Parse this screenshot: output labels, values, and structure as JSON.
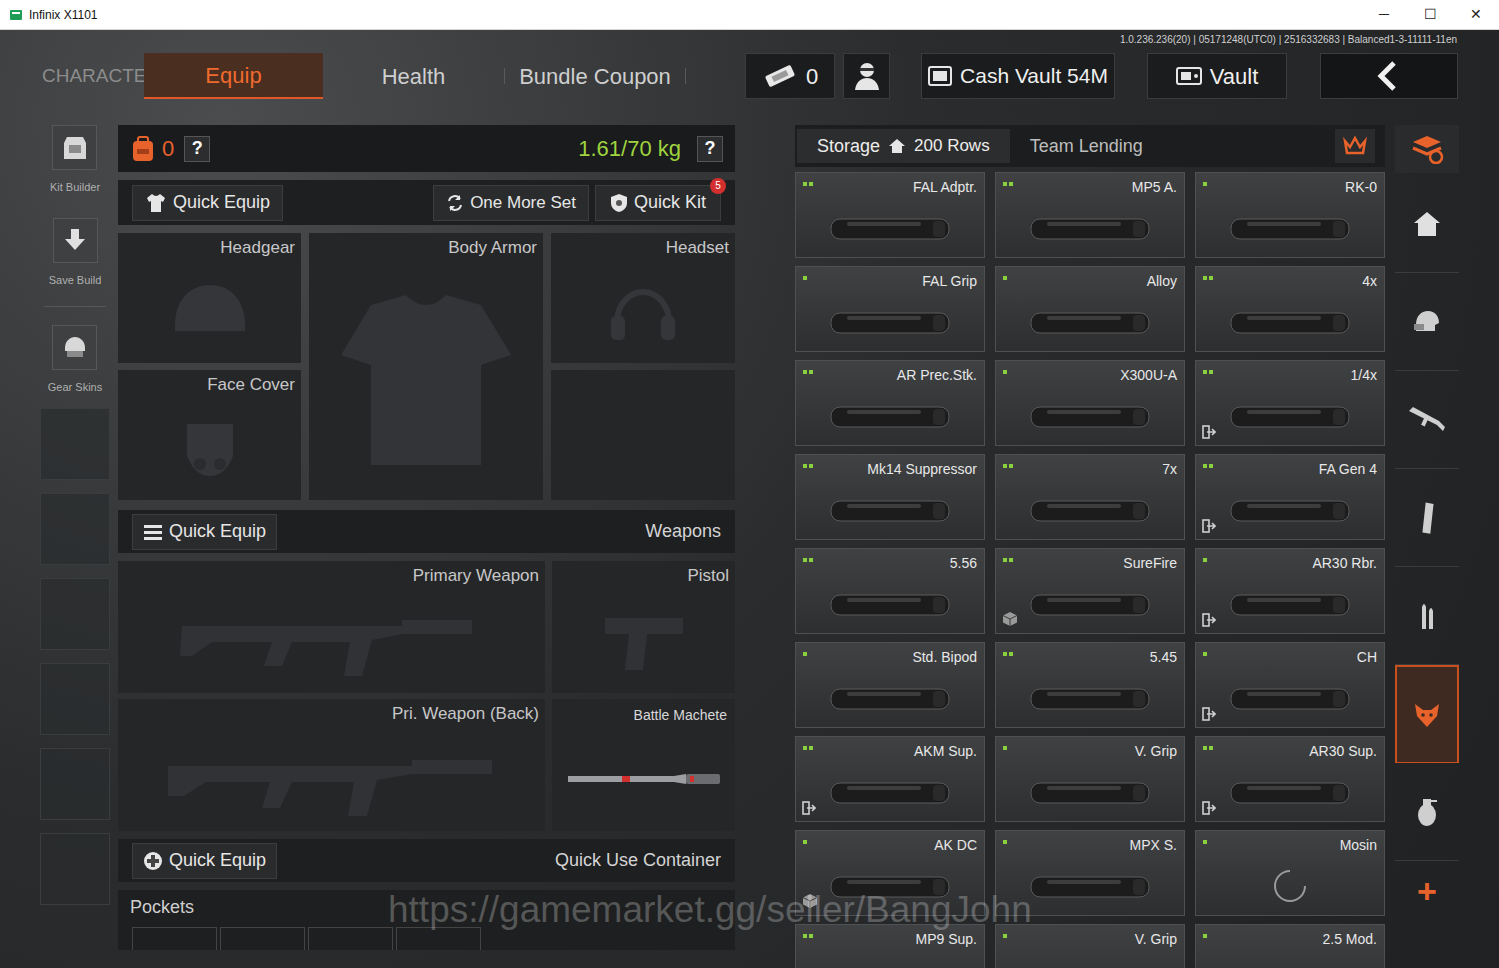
{
  "window": {
    "title": "Infinix X1101",
    "controls": [
      "─",
      "☐",
      "✕"
    ]
  },
  "version": "1.0.236.236(20) | 05171248(UTC0) | 2516332683 | Balanced1-3-11111-11en",
  "nav": {
    "tabs": [
      {
        "label": "CHARACTER",
        "kind": "section",
        "selected": false
      },
      {
        "label": "Equip",
        "kind": "tab",
        "selected": true
      },
      {
        "label": "Health",
        "kind": "tab",
        "selected": false
      },
      {
        "label": "Bundle Coupon",
        "kind": "tab",
        "selected": false
      }
    ],
    "tickets": "0",
    "cash_vault": "Cash Vault 54M",
    "vault": "Vault"
  },
  "sidebar": {
    "items": [
      {
        "label": "Kit Builder"
      },
      {
        "label": "Save Build"
      },
      {
        "label": "Gear Skins"
      }
    ]
  },
  "loadout": {
    "backpack_count": "0",
    "help": "?",
    "weight": "1.61/70 kg",
    "weight_help": "?",
    "quick_equip": "Quick Equip",
    "one_more_set": "One More Set",
    "quick_kit": "Quick Kit",
    "quick_kit_badge": "5",
    "gear_slots": [
      {
        "label": "Headgear"
      },
      {
        "label": "Body Armor"
      },
      {
        "label": "Headset"
      },
      {
        "label": "Face Cover"
      }
    ],
    "weapons_header": {
      "button": "Quick Equip",
      "title": "Weapons"
    },
    "weapon_slots": [
      {
        "label": "Primary Weapon",
        "kind": "empty"
      },
      {
        "label": "Pistol",
        "kind": "empty"
      },
      {
        "label": "Pri. Weapon (Back)",
        "kind": "empty"
      },
      {
        "label": "Battle Machete",
        "kind": "equipped"
      }
    ],
    "quick_use": {
      "button": "Quick Equip",
      "title": "Quick Use Container"
    },
    "pockets": "Pockets"
  },
  "storage": {
    "tab": "Storage",
    "rows": "200 Rows",
    "team_lending": "Team Lending",
    "items": [
      {
        "name": "FAL Adptr.",
        "dots": 2,
        "kind": "plain"
      },
      {
        "name": "MP5 A.",
        "dots": 2,
        "kind": "plain"
      },
      {
        "name": "RK-0",
        "dots": 1,
        "kind": "plain"
      },
      {
        "name": "FAL Grip",
        "dots": 1,
        "kind": "plain"
      },
      {
        "name": "Alloy",
        "dots": 1,
        "kind": "plain"
      },
      {
        "name": "4x",
        "dots": 2,
        "kind": "plain"
      },
      {
        "name": "AR Prec.Stk.",
        "dots": 2,
        "kind": "plain"
      },
      {
        "name": "X300U-A",
        "dots": 1,
        "kind": "plain"
      },
      {
        "name": "1/4x",
        "dots": 2,
        "kind": "exit"
      },
      {
        "name": "Mk14 Suppressor",
        "dots": 2,
        "kind": "plain"
      },
      {
        "name": "7x",
        "dots": 2,
        "kind": "plain"
      },
      {
        "name": "FA Gen 4",
        "dots": 2,
        "kind": "exit"
      },
      {
        "name": "5.56",
        "dots": 2,
        "kind": "plain"
      },
      {
        "name": "SureFire",
        "dots": 2,
        "kind": "cube"
      },
      {
        "name": "AR30 Rbr.",
        "dots": 1,
        "kind": "exit"
      },
      {
        "name": "Std. Bipod",
        "dots": 1,
        "kind": "plain"
      },
      {
        "name": "5.45",
        "dots": 2,
        "kind": "plain"
      },
      {
        "name": "CH",
        "dots": 1,
        "kind": "exit"
      },
      {
        "name": "AKM Sup.",
        "dots": 2,
        "kind": "exit"
      },
      {
        "name": "V. Grip",
        "dots": 1,
        "kind": "plain"
      },
      {
        "name": "AR30 Sup.",
        "dots": 2,
        "kind": "exit"
      },
      {
        "name": "AK DC",
        "dots": 1,
        "kind": "cube"
      },
      {
        "name": "MPX S.",
        "dots": 1,
        "kind": "plain"
      },
      {
        "name": "Mosin",
        "dots": 1,
        "kind": "loading"
      },
      {
        "name": "MP9 Sup.",
        "dots": 2,
        "kind": "plain"
      },
      {
        "name": "V. Grip",
        "dots": 1,
        "kind": "plain"
      },
      {
        "name": "2.5 Mod.",
        "dots": 1,
        "kind": "plain"
      }
    ]
  },
  "rail": {
    "items": [
      {
        "selected": false
      },
      {
        "selected": false
      },
      {
        "selected": false
      },
      {
        "selected": false
      },
      {
        "selected": false
      },
      {
        "selected": false
      },
      {
        "selected": true
      },
      {
        "selected": false
      }
    ],
    "add": "+"
  },
  "watermark": "https://gamemarket.gg/seller/BangJohn"
}
